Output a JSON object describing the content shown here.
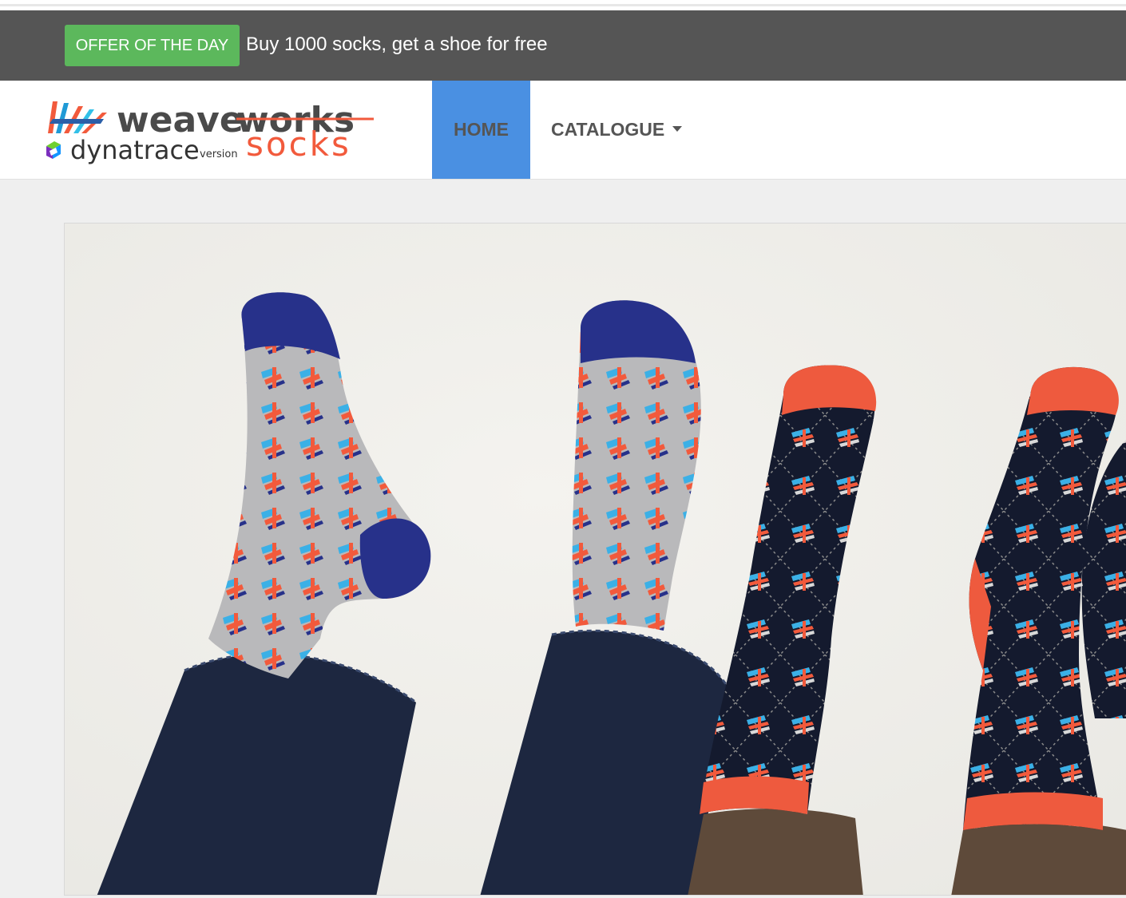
{
  "offer": {
    "badge_label": "Offer of the day",
    "text": "Buy 1000 socks, get a shoe for free"
  },
  "logo": {
    "word_weave": "weave",
    "word_works": "works",
    "word_dynatrace": "dynatrace",
    "word_version": "version",
    "word_socks": "socks"
  },
  "nav": {
    "home_label": "Home",
    "catalogue_label": "Catalogue"
  },
  "hero": {
    "icon": "hero-socks-photo"
  },
  "colors": {
    "offer_bar": "#555555",
    "offer_badge": "#5cb85c",
    "nav_active": "#4a90e2",
    "nav_text": "#555555",
    "logo_accent": "#f25a3c"
  }
}
